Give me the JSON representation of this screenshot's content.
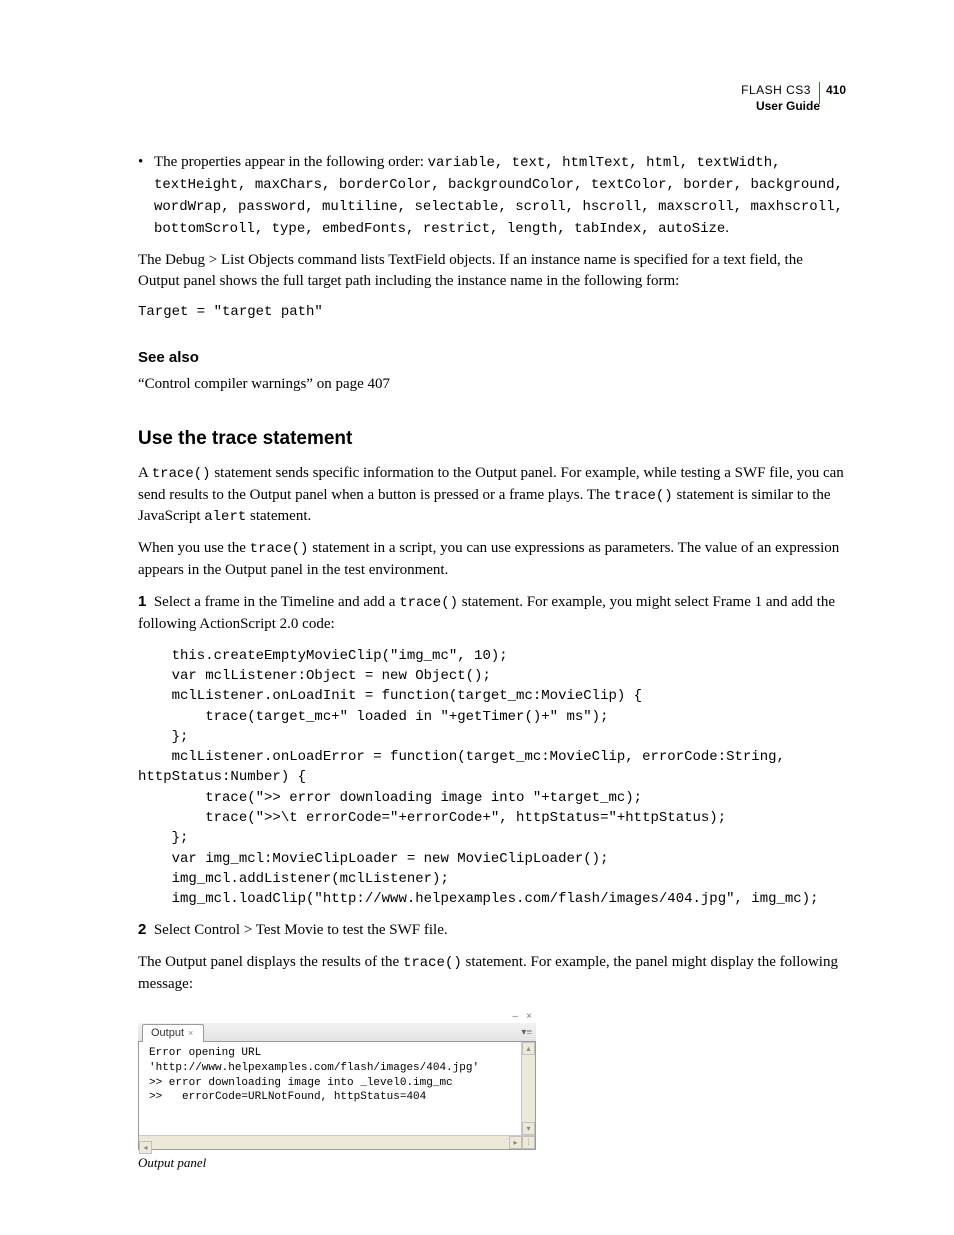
{
  "header": {
    "product": "FLASH CS3",
    "page_number": "410",
    "guide": "User Guide"
  },
  "bullet": {
    "lead": "The properties appear in the following order: ",
    "props": "variable, text, htmlText, html, textWidth, textHeight, maxChars, borderColor, backgroundColor, textColor, border, background, wordWrap, password, multiline, selectable, scroll, hscroll, maxscroll, maxhscroll, bottomScroll, type, embedFonts, restrict, length, tabIndex, autoSize",
    "trail": "."
  },
  "para_debug": "The Debug > List Objects command lists TextField objects. If an instance name is specified for a text field, the Output panel shows the full target path including the instance name in the following form:",
  "code_target": "Target = \"target path\"",
  "see_also": {
    "head": "See also",
    "link": "“Control compiler warnings” on page 407"
  },
  "section": {
    "title": "Use the trace statement",
    "p1_a": "A ",
    "p1_code1": "trace()",
    "p1_b": " statement sends specific information to the Output panel. For example, while testing a SWF file, you can send results to the Output panel when a button is pressed or a frame plays. The ",
    "p1_code2": "trace()",
    "p1_c": " statement is similar to the JavaScript ",
    "p1_code3": "alert",
    "p1_d": " statement.",
    "p2_a": "When you use the ",
    "p2_code1": "trace()",
    "p2_b": " statement in a script, you can use expressions as parameters. The value of an expression appears in the Output panel in the test environment.",
    "step1_num": "1",
    "step1_a": "Select a frame in the Timeline and add a ",
    "step1_code": "trace()",
    "step1_b": " statement. For example, you might select Frame 1 and add the following ActionScript 2.0 code:",
    "codeblock": "    this.createEmptyMovieClip(\"img_mc\", 10);\n    var mclListener:Object = new Object();\n    mclListener.onLoadInit = function(target_mc:MovieClip) {\n        trace(target_mc+\" loaded in \"+getTimer()+\" ms\");\n    };\n    mclListener.onLoadError = function(target_mc:MovieClip, errorCode:String,\nhttpStatus:Number) {\n        trace(\">> error downloading image into \"+target_mc);\n        trace(\">>\\t errorCode=\"+errorCode+\", httpStatus=\"+httpStatus);\n    };\n    var img_mcl:MovieClipLoader = new MovieClipLoader();\n    img_mcl.addListener(mclListener);\n    img_mcl.loadClip(\"http://www.helpexamples.com/flash/images/404.jpg\", img_mc);",
    "step2_num": "2",
    "step2": "Select Control > Test Movie to test the SWF file.",
    "p3_a": "The Output panel displays the results of the ",
    "p3_code": "trace()",
    "p3_b": " statement. For example, the panel might display the following message:"
  },
  "panel": {
    "tab": "Output",
    "lines": "Error opening URL\n'http://www.helpexamples.com/flash/images/404.jpg'\n>> error downloading image into _level0.img_mc\n>>   errorCode=URLNotFound, httpStatus=404",
    "caption": "Output panel"
  }
}
